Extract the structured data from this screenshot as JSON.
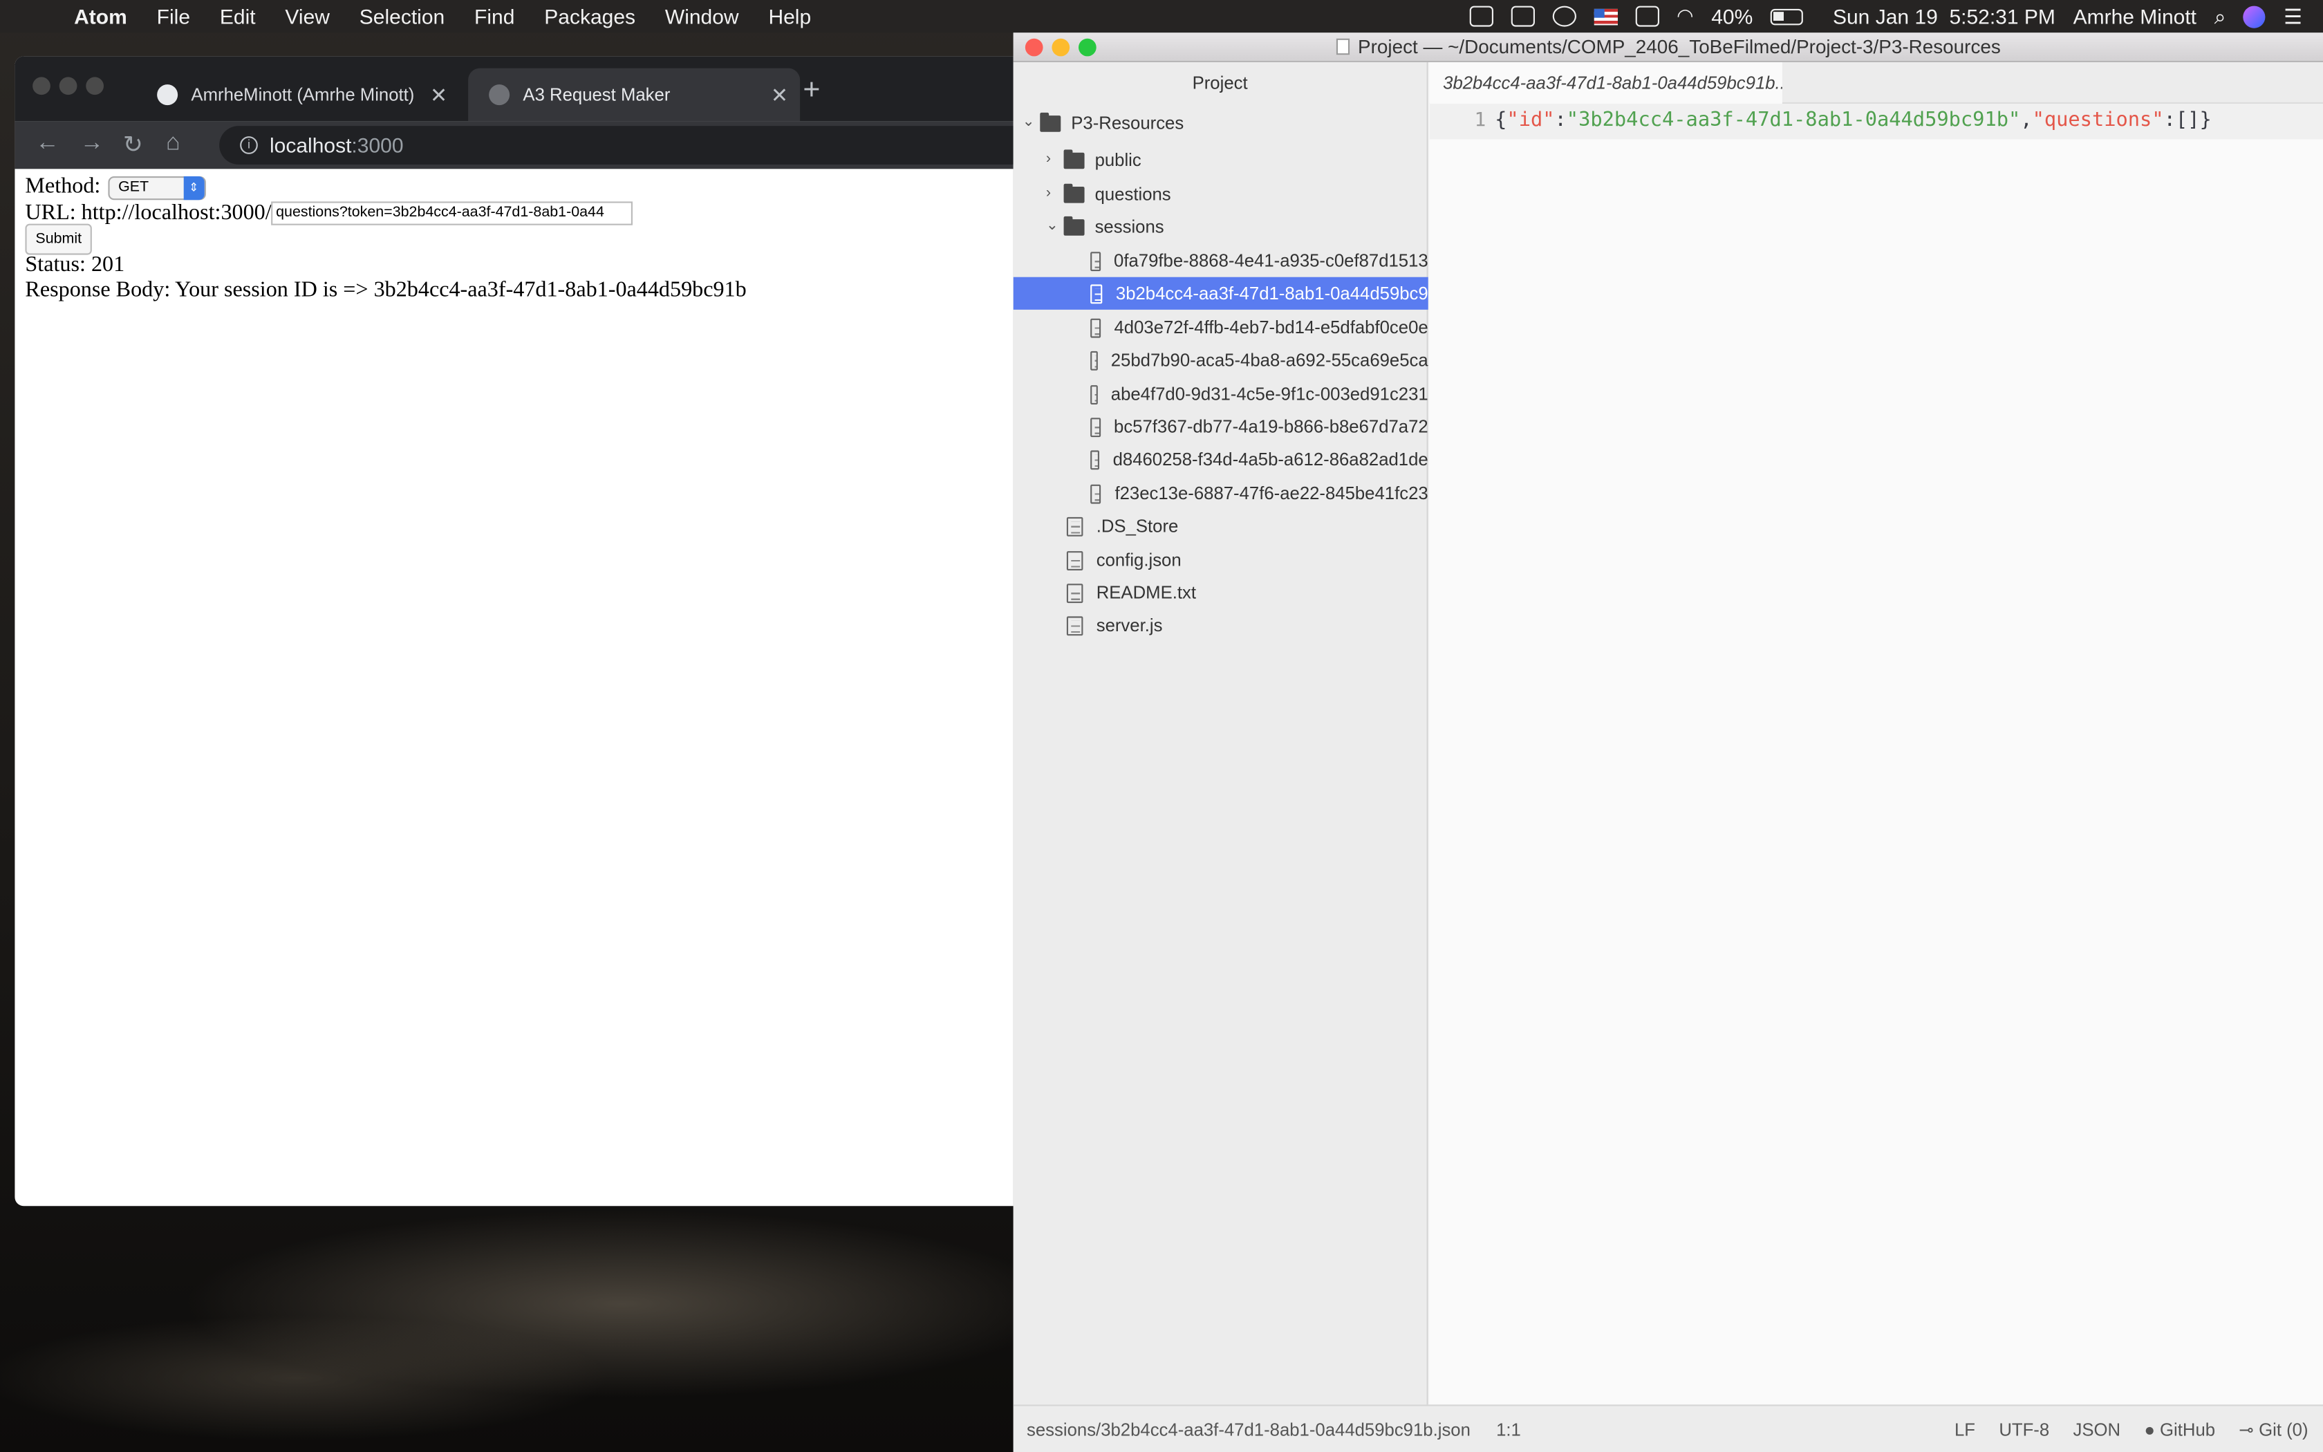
{
  "menubar": {
    "app": "Atom",
    "items": [
      "File",
      "Edit",
      "View",
      "Selection",
      "Find",
      "Packages",
      "Window",
      "Help"
    ],
    "battery": "40%",
    "clock": "Sun Jan 19  5:52:31 PM",
    "user": "Amrhe Minott"
  },
  "browser": {
    "tabs": [
      {
        "title": "AmrheMinott (Amrhe Minott)",
        "active": false
      },
      {
        "title": "A3 Request Maker",
        "active": true
      }
    ],
    "address_host": "localhost",
    "address_port": ":3000",
    "page": {
      "method_label": "Method:",
      "method_value": "GET",
      "url_label": "URL: http://localhost:3000/",
      "url_value": "questions?token=3b2b4cc4-aa3f-47d1-8ab1-0a44",
      "submit_label": "Submit",
      "status": "Status: 201",
      "response": "Response Body: Your session ID is => 3b2b4cc4-aa3f-47d1-8ab1-0a44d59bc91b"
    }
  },
  "atom": {
    "title": "Project — ~/Documents/COMP_2406_ToBeFilmed/Project-3/P3-Resources",
    "tree_header": "Project",
    "root": "P3-Resources",
    "folders": [
      "public",
      "questions",
      "sessions"
    ],
    "session_files": [
      "0fa79fbe-8868-4e41-a935-c0ef87d1513",
      "3b2b4cc4-aa3f-47d1-8ab1-0a44d59bc9",
      "4d03e72f-4ffb-4eb7-bd14-e5dfabf0ce0e",
      "25bd7b90-aca5-4ba8-a692-55ca69e5ca",
      "abe4f7d0-9d31-4c5e-9f1c-003ed91c231",
      "bc57f367-db77-4a19-b866-b8e67d7a72",
      "d8460258-f34d-4a5b-a612-86a82ad1de",
      "f23ec13e-6887-47f6-ae22-845be41fc23"
    ],
    "root_files": [
      ".DS_Store",
      "config.json",
      "README.txt",
      "server.js"
    ],
    "editor_tab": "3b2b4cc4-aa3f-47d1-8ab1-0a44d59bc91b...",
    "line_number": "1",
    "code": {
      "brace_open": "{",
      "key1": "\"id\"",
      "colon": ":",
      "val1": "\"3b2b4cc4-aa3f-47d1-8ab1-0a44d59bc91b\"",
      "comma": ",",
      "key2": "\"questions\"",
      "colon2": ":",
      "arr": "[]",
      "brace_close": "}"
    },
    "status": {
      "path": "sessions/3b2b4cc4-aa3f-47d1-8ab1-0a44d59bc91b.json",
      "cursor": "1:1",
      "line_ending": "LF",
      "encoding": "UTF-8",
      "grammar": "JSON",
      "github": "GitHub",
      "git": "Git (0)"
    }
  }
}
